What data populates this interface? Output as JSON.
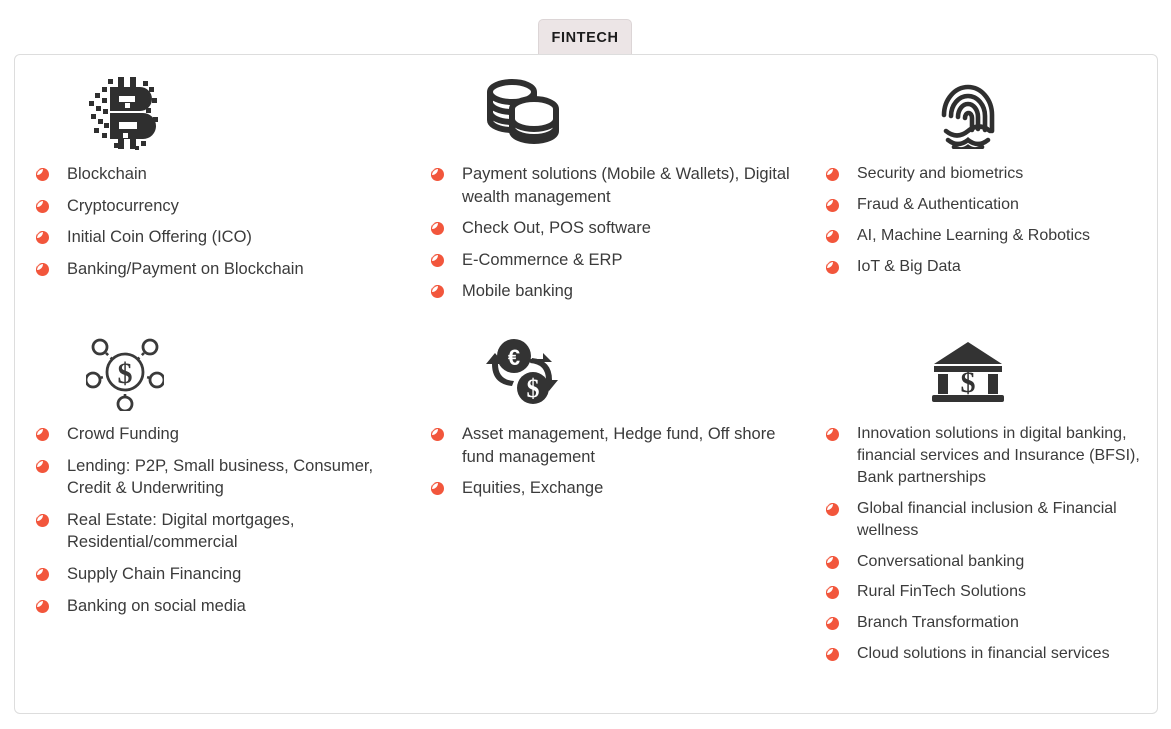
{
  "tab": {
    "label": "FINTECH",
    "active": true
  },
  "theme": {
    "bullet_color": "#f2563c",
    "icon_color": "#333333",
    "text_color": "#3b3b3b",
    "tab_background": "#ece5e6",
    "panel_border": "#dddddd"
  },
  "panel": {
    "groups": [
      {
        "id": "blockchain",
        "icon": "bitcoin-pixel-icon",
        "items": [
          "Blockchain",
          "Cryptocurrency",
          "Initial Coin Offering (ICO)",
          "Banking/Payment on Blockchain"
        ]
      },
      {
        "id": "payments",
        "icon": "coin-stacks-icon",
        "items": [
          "Payment solutions (Mobile & Wallets), Digital wealth management",
          "Check Out, POS software",
          "E-Commernce & ERP",
          "Mobile banking"
        ]
      },
      {
        "id": "security",
        "icon": "fingerprint-icon",
        "items": [
          "Security and biometrics",
          "Fraud & Authentication",
          "AI, Machine Learning & Robotics",
          "IoT & Big Data"
        ]
      },
      {
        "id": "funding",
        "icon": "crowdfunding-network-icon",
        "items": [
          "Crowd Funding",
          "Lending: P2P, Small business, Consumer, Credit & Underwriting",
          "Real Estate: Digital mortgages, Residential/commercial",
          "Supply Chain Financing",
          "Banking on social media"
        ]
      },
      {
        "id": "investments",
        "icon": "currency-exchange-icon",
        "items": [
          "Asset management, Hedge fund, Off shore fund management",
          "Equities, Exchange"
        ]
      },
      {
        "id": "banking-innovation",
        "icon": "bank-building-icon",
        "items": [
          "Innovation solutions in digital banking, financial services and Insurance (BFSI), Bank partnerships",
          "Global financial inclusion & Financial wellness",
          "Conversational banking",
          "Rural FinTech Solutions",
          "Branch Transformation",
          "Cloud solutions in financial services"
        ]
      }
    ]
  }
}
